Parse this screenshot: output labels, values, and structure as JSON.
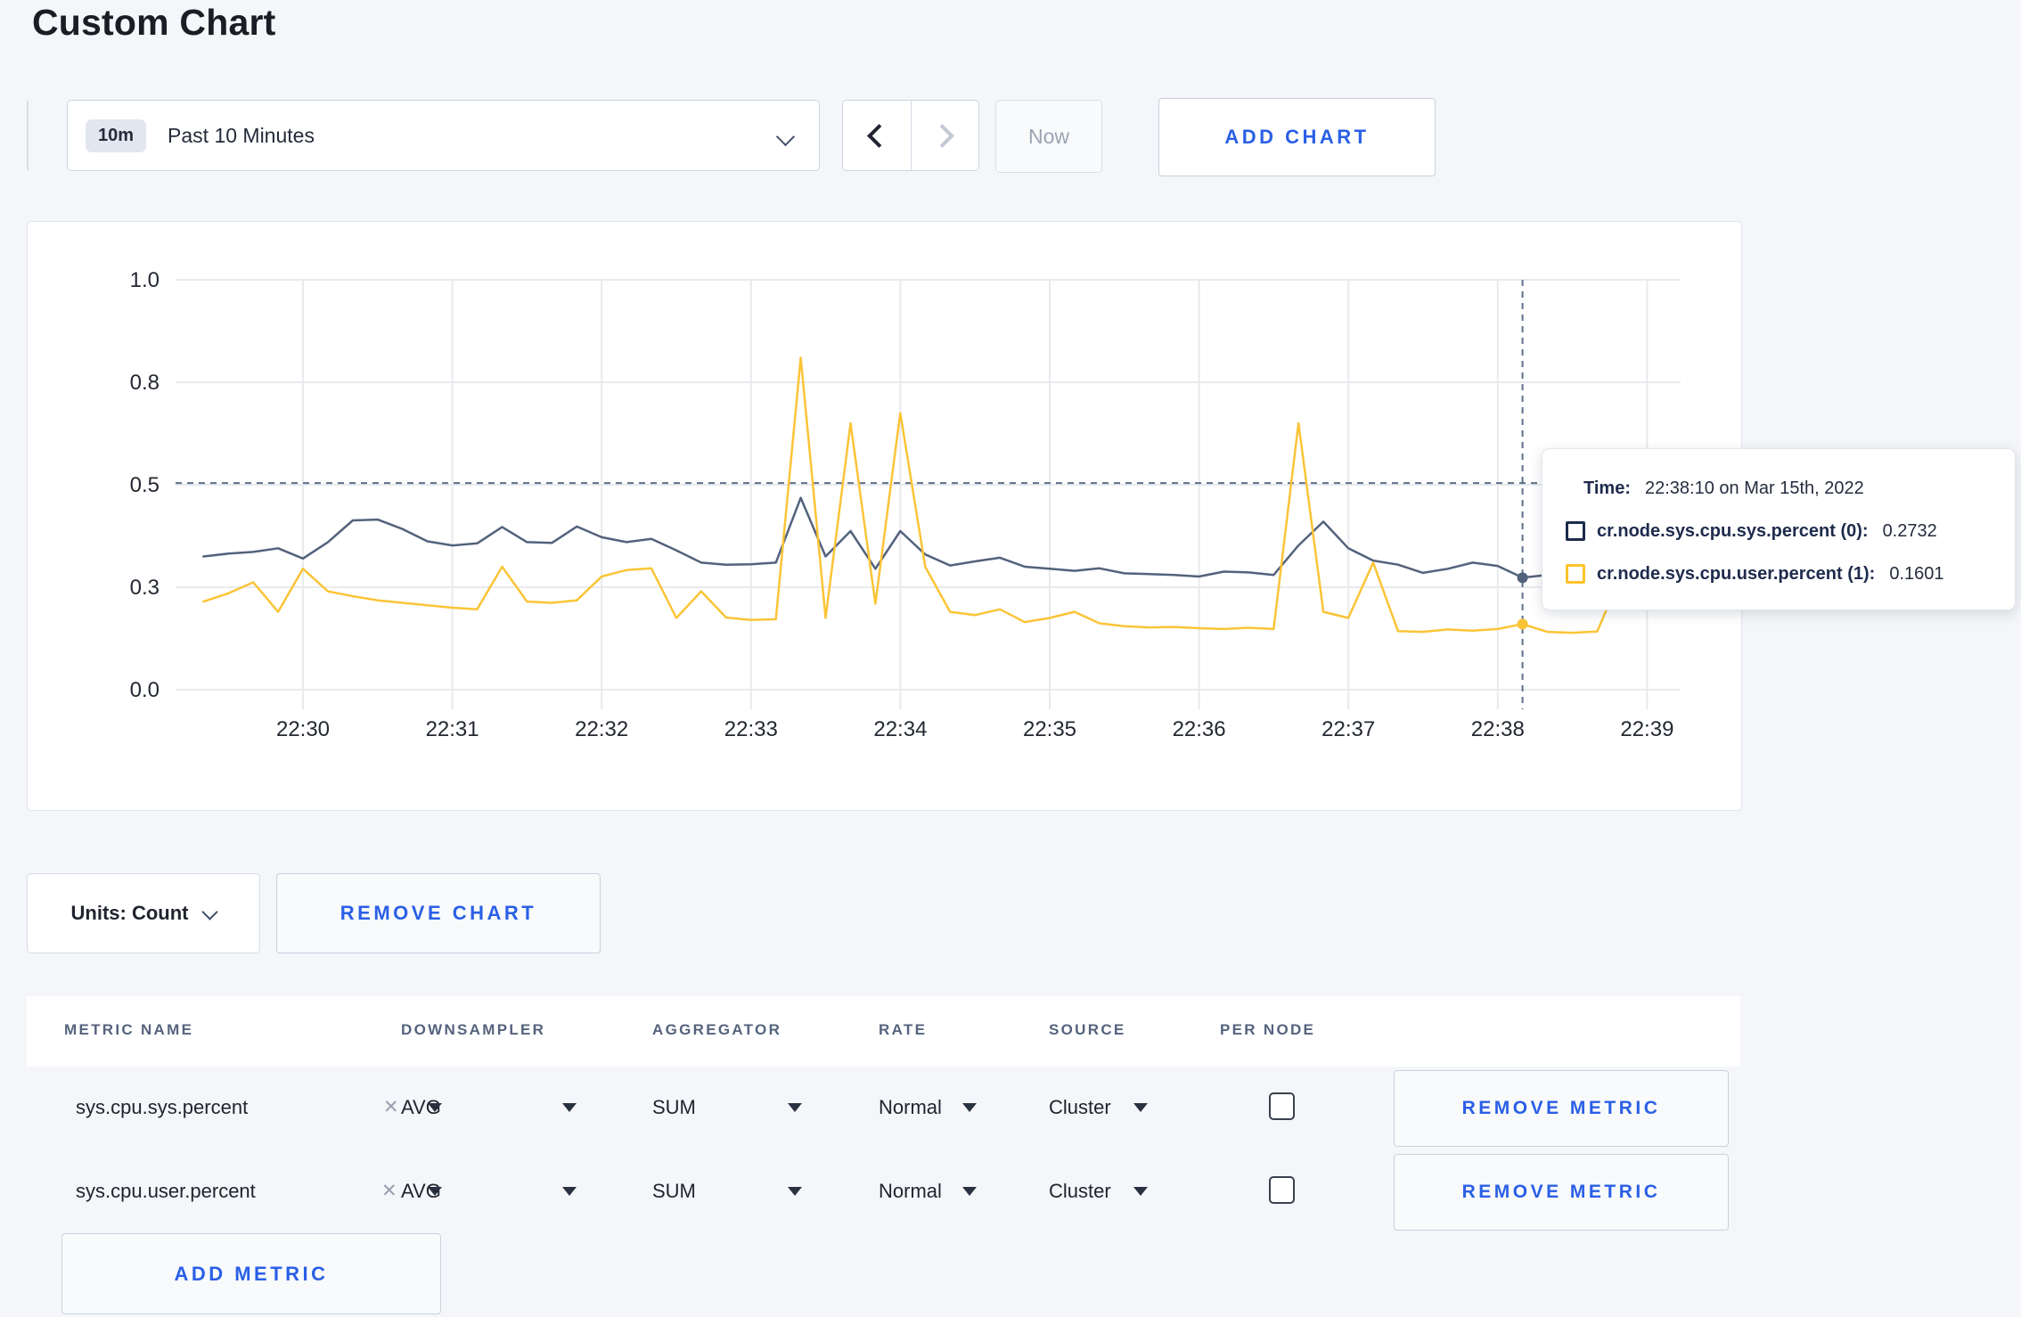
{
  "page": {
    "title": "Custom Chart"
  },
  "toolbar": {
    "range_badge": "10m",
    "range_label": "Past 10 Minutes",
    "prev_icon": "chevron-left",
    "next_icon": "chevron-right",
    "now_label": "Now",
    "add_chart_label": "ADD CHART"
  },
  "chart_data": {
    "type": "line",
    "title": "",
    "xlabel": "",
    "ylabel": "",
    "ylim": [
      0,
      1
    ],
    "grid": true,
    "x_start_time": "22:29:20",
    "x_interval_seconds": 10,
    "x_tick_labels": [
      "22:30",
      "22:31",
      "22:32",
      "22:33",
      "22:34",
      "22:35",
      "22:36",
      "22:37",
      "22:38",
      "22:39"
    ],
    "y_ticks": [
      {
        "label": "0.0",
        "value": 0.0
      },
      {
        "label": "0.3",
        "value": 0.25
      },
      {
        "label": "0.5",
        "value": 0.5
      },
      {
        "label": "0.8",
        "value": 0.75
      },
      {
        "label": "1.0",
        "value": 1.0
      }
    ],
    "series": [
      {
        "name": "cr.node.sys.cpu.sys.percent (0)",
        "color": "#53627C",
        "values": [
          0.325,
          0.332,
          0.336,
          0.345,
          0.32,
          0.36,
          0.413,
          0.415,
          0.392,
          0.362,
          0.352,
          0.357,
          0.397,
          0.36,
          0.358,
          0.398,
          0.372,
          0.36,
          0.368,
          0.34,
          0.31,
          0.305,
          0.306,
          0.31,
          0.468,
          0.325,
          0.387,
          0.295,
          0.387,
          0.33,
          0.303,
          0.313,
          0.322,
          0.3,
          0.295,
          0.29,
          0.296,
          0.284,
          0.282,
          0.28,
          0.276,
          0.288,
          0.286,
          0.28,
          0.352,
          0.41,
          0.345,
          0.315,
          0.305,
          0.285,
          0.295,
          0.31,
          0.302,
          0.2732,
          0.28,
          0.285,
          0.295,
          0.302,
          0.29,
          0.3
        ]
      },
      {
        "name": "cr.node.sys.cpu.user.percent (1)",
        "color": "#FBC437",
        "values": [
          0.215,
          0.235,
          0.262,
          0.19,
          0.295,
          0.24,
          0.228,
          0.218,
          0.212,
          0.206,
          0.2,
          0.196,
          0.3,
          0.215,
          0.212,
          0.218,
          0.276,
          0.292,
          0.296,
          0.175,
          0.24,
          0.176,
          0.17,
          0.172,
          0.81,
          0.175,
          0.65,
          0.21,
          0.675,
          0.3,
          0.19,
          0.182,
          0.196,
          0.165,
          0.175,
          0.19,
          0.162,
          0.155,
          0.152,
          0.153,
          0.15,
          0.148,
          0.151,
          0.148,
          0.65,
          0.19,
          0.175,
          0.31,
          0.143,
          0.141,
          0.147,
          0.144,
          0.148,
          0.1601,
          0.141,
          0.139,
          0.142,
          0.285,
          0.235,
          0.265
        ]
      }
    ],
    "hover": {
      "index": 53,
      "time": "22:38:10",
      "hline_value": 0.504,
      "crosshair_color": "#5C7089"
    },
    "legend_position": "tooltip",
    "gridline_color": "#E9EAEE"
  },
  "tooltip": {
    "time_label": "Time:",
    "time_value": "22:38:10 on Mar 15th, 2022",
    "rows": [
      {
        "label": "cr.node.sys.cpu.sys.percent (0):",
        "value": "0.2732",
        "color": "#1C2B4A"
      },
      {
        "label": "cr.node.sys.cpu.user.percent (1):",
        "value": "0.1601",
        "color": "#FFC32B"
      }
    ]
  },
  "chart_controls": {
    "units_label": "Units: Count",
    "remove_chart_label": "REMOVE CHART"
  },
  "metrics_table": {
    "headers": [
      "METRIC NAME",
      "DOWNSAMPLER",
      "AGGREGATOR",
      "RATE",
      "SOURCE",
      "PER NODE"
    ],
    "rows": [
      {
        "metric": "sys.cpu.sys.percent",
        "downsampler": "AVG",
        "aggregator": "SUM",
        "rate": "Normal",
        "source": "Cluster",
        "per_node_checked": false,
        "remove_label": "REMOVE METRIC"
      },
      {
        "metric": "sys.cpu.user.percent",
        "downsampler": "AVG",
        "aggregator": "SUM",
        "rate": "Normal",
        "source": "Cluster",
        "per_node_checked": false,
        "remove_label": "REMOVE METRIC"
      }
    ],
    "add_metric_label": "ADD METRIC"
  },
  "colors": {
    "accent_blue": "#2A5FE6",
    "page_background": "#F4F6F9",
    "card_background": "#FFFFFF"
  }
}
